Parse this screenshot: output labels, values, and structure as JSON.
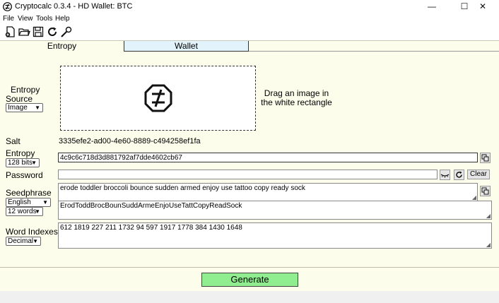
{
  "window": {
    "title": "Cryptocalc 0.3.4 - HD Wallet: BTC",
    "controls": {
      "minimize": "—",
      "maximize": "☐",
      "close": "✕"
    }
  },
  "menu": {
    "file": "File",
    "view": "View",
    "tools": "Tools",
    "help": "Help"
  },
  "toolbar": {
    "icons": [
      "new-file-icon",
      "open-folder-icon",
      "save-icon",
      "refresh-icon",
      "tools-icon"
    ]
  },
  "tabs": {
    "entropy": "Entropy",
    "wallet": "Wallet"
  },
  "entropy": {
    "label_line1": "Entropy",
    "label_line2": "Source",
    "source_value": "Image",
    "drag_hint_line1": "Drag an image in",
    "drag_hint_line2": "the white rectangle"
  },
  "salt": {
    "label": "Salt",
    "value": "3335efe2-ad00-4e60-8889-c494258ef1fa"
  },
  "entropy_field": {
    "label": "Entropy",
    "bits": "128 bits",
    "value": "4c9c6c718d3d881792af7dde4602cb67"
  },
  "password": {
    "label": "Password",
    "value": "",
    "clear_label": "Clear"
  },
  "seedphrase": {
    "label": "Seedphrase",
    "language": "English",
    "word_count": "12 words",
    "words": "erode toddler broccoli bounce sudden armed enjoy use tattoo copy ready sock",
    "compact": "ErodToddBrocBounSuddArmeEnjoUseTattCopyReadSock"
  },
  "word_indexes": {
    "label": "Word Indexes",
    "format": "Decimal",
    "value": "612 1819 227 211 1732 94 597 1917 1778 384 1430 1648"
  },
  "actions": {
    "generate": "Generate"
  },
  "colors": {
    "content_bg": "#fdfdec",
    "wallet_tab_bg": "#e3f3fb",
    "generate_bg": "#90ee90"
  }
}
